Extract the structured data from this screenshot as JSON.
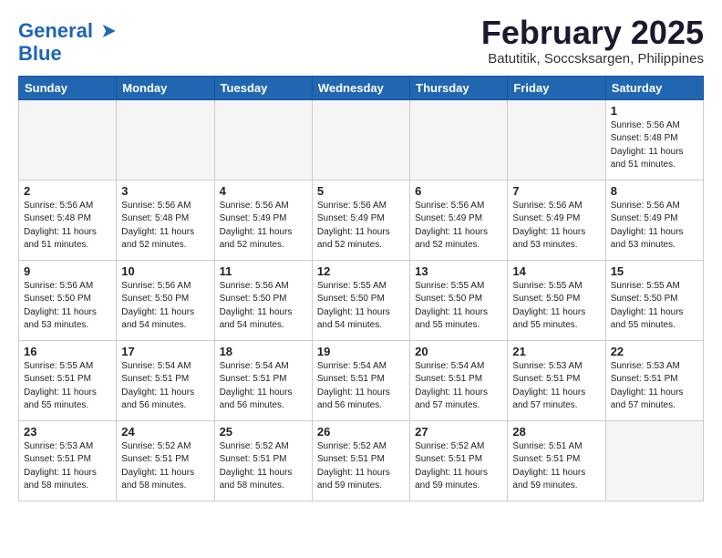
{
  "logo": {
    "line1": "General",
    "line2": "Blue"
  },
  "title": "February 2025",
  "location": "Batutitik, Soccsksargen, Philippines",
  "weekdays": [
    "Sunday",
    "Monday",
    "Tuesday",
    "Wednesday",
    "Thursday",
    "Friday",
    "Saturday"
  ],
  "weeks": [
    [
      {
        "day": "",
        "info": ""
      },
      {
        "day": "",
        "info": ""
      },
      {
        "day": "",
        "info": ""
      },
      {
        "day": "",
        "info": ""
      },
      {
        "day": "",
        "info": ""
      },
      {
        "day": "",
        "info": ""
      },
      {
        "day": "1",
        "info": "Sunrise: 5:56 AM\nSunset: 5:48 PM\nDaylight: 11 hours\nand 51 minutes."
      }
    ],
    [
      {
        "day": "2",
        "info": "Sunrise: 5:56 AM\nSunset: 5:48 PM\nDaylight: 11 hours\nand 51 minutes."
      },
      {
        "day": "3",
        "info": "Sunrise: 5:56 AM\nSunset: 5:48 PM\nDaylight: 11 hours\nand 52 minutes."
      },
      {
        "day": "4",
        "info": "Sunrise: 5:56 AM\nSunset: 5:49 PM\nDaylight: 11 hours\nand 52 minutes."
      },
      {
        "day": "5",
        "info": "Sunrise: 5:56 AM\nSunset: 5:49 PM\nDaylight: 11 hours\nand 52 minutes."
      },
      {
        "day": "6",
        "info": "Sunrise: 5:56 AM\nSunset: 5:49 PM\nDaylight: 11 hours\nand 52 minutes."
      },
      {
        "day": "7",
        "info": "Sunrise: 5:56 AM\nSunset: 5:49 PM\nDaylight: 11 hours\nand 53 minutes."
      },
      {
        "day": "8",
        "info": "Sunrise: 5:56 AM\nSunset: 5:49 PM\nDaylight: 11 hours\nand 53 minutes."
      }
    ],
    [
      {
        "day": "9",
        "info": "Sunrise: 5:56 AM\nSunset: 5:50 PM\nDaylight: 11 hours\nand 53 minutes."
      },
      {
        "day": "10",
        "info": "Sunrise: 5:56 AM\nSunset: 5:50 PM\nDaylight: 11 hours\nand 54 minutes."
      },
      {
        "day": "11",
        "info": "Sunrise: 5:56 AM\nSunset: 5:50 PM\nDaylight: 11 hours\nand 54 minutes."
      },
      {
        "day": "12",
        "info": "Sunrise: 5:55 AM\nSunset: 5:50 PM\nDaylight: 11 hours\nand 54 minutes."
      },
      {
        "day": "13",
        "info": "Sunrise: 5:55 AM\nSunset: 5:50 PM\nDaylight: 11 hours\nand 55 minutes."
      },
      {
        "day": "14",
        "info": "Sunrise: 5:55 AM\nSunset: 5:50 PM\nDaylight: 11 hours\nand 55 minutes."
      },
      {
        "day": "15",
        "info": "Sunrise: 5:55 AM\nSunset: 5:50 PM\nDaylight: 11 hours\nand 55 minutes."
      }
    ],
    [
      {
        "day": "16",
        "info": "Sunrise: 5:55 AM\nSunset: 5:51 PM\nDaylight: 11 hours\nand 55 minutes."
      },
      {
        "day": "17",
        "info": "Sunrise: 5:54 AM\nSunset: 5:51 PM\nDaylight: 11 hours\nand 56 minutes."
      },
      {
        "day": "18",
        "info": "Sunrise: 5:54 AM\nSunset: 5:51 PM\nDaylight: 11 hours\nand 56 minutes."
      },
      {
        "day": "19",
        "info": "Sunrise: 5:54 AM\nSunset: 5:51 PM\nDaylight: 11 hours\nand 56 minutes."
      },
      {
        "day": "20",
        "info": "Sunrise: 5:54 AM\nSunset: 5:51 PM\nDaylight: 11 hours\nand 57 minutes."
      },
      {
        "day": "21",
        "info": "Sunrise: 5:53 AM\nSunset: 5:51 PM\nDaylight: 11 hours\nand 57 minutes."
      },
      {
        "day": "22",
        "info": "Sunrise: 5:53 AM\nSunset: 5:51 PM\nDaylight: 11 hours\nand 57 minutes."
      }
    ],
    [
      {
        "day": "23",
        "info": "Sunrise: 5:53 AM\nSunset: 5:51 PM\nDaylight: 11 hours\nand 58 minutes."
      },
      {
        "day": "24",
        "info": "Sunrise: 5:52 AM\nSunset: 5:51 PM\nDaylight: 11 hours\nand 58 minutes."
      },
      {
        "day": "25",
        "info": "Sunrise: 5:52 AM\nSunset: 5:51 PM\nDaylight: 11 hours\nand 58 minutes."
      },
      {
        "day": "26",
        "info": "Sunrise: 5:52 AM\nSunset: 5:51 PM\nDaylight: 11 hours\nand 59 minutes."
      },
      {
        "day": "27",
        "info": "Sunrise: 5:52 AM\nSunset: 5:51 PM\nDaylight: 11 hours\nand 59 minutes."
      },
      {
        "day": "28",
        "info": "Sunrise: 5:51 AM\nSunset: 5:51 PM\nDaylight: 11 hours\nand 59 minutes."
      },
      {
        "day": "",
        "info": ""
      }
    ]
  ]
}
